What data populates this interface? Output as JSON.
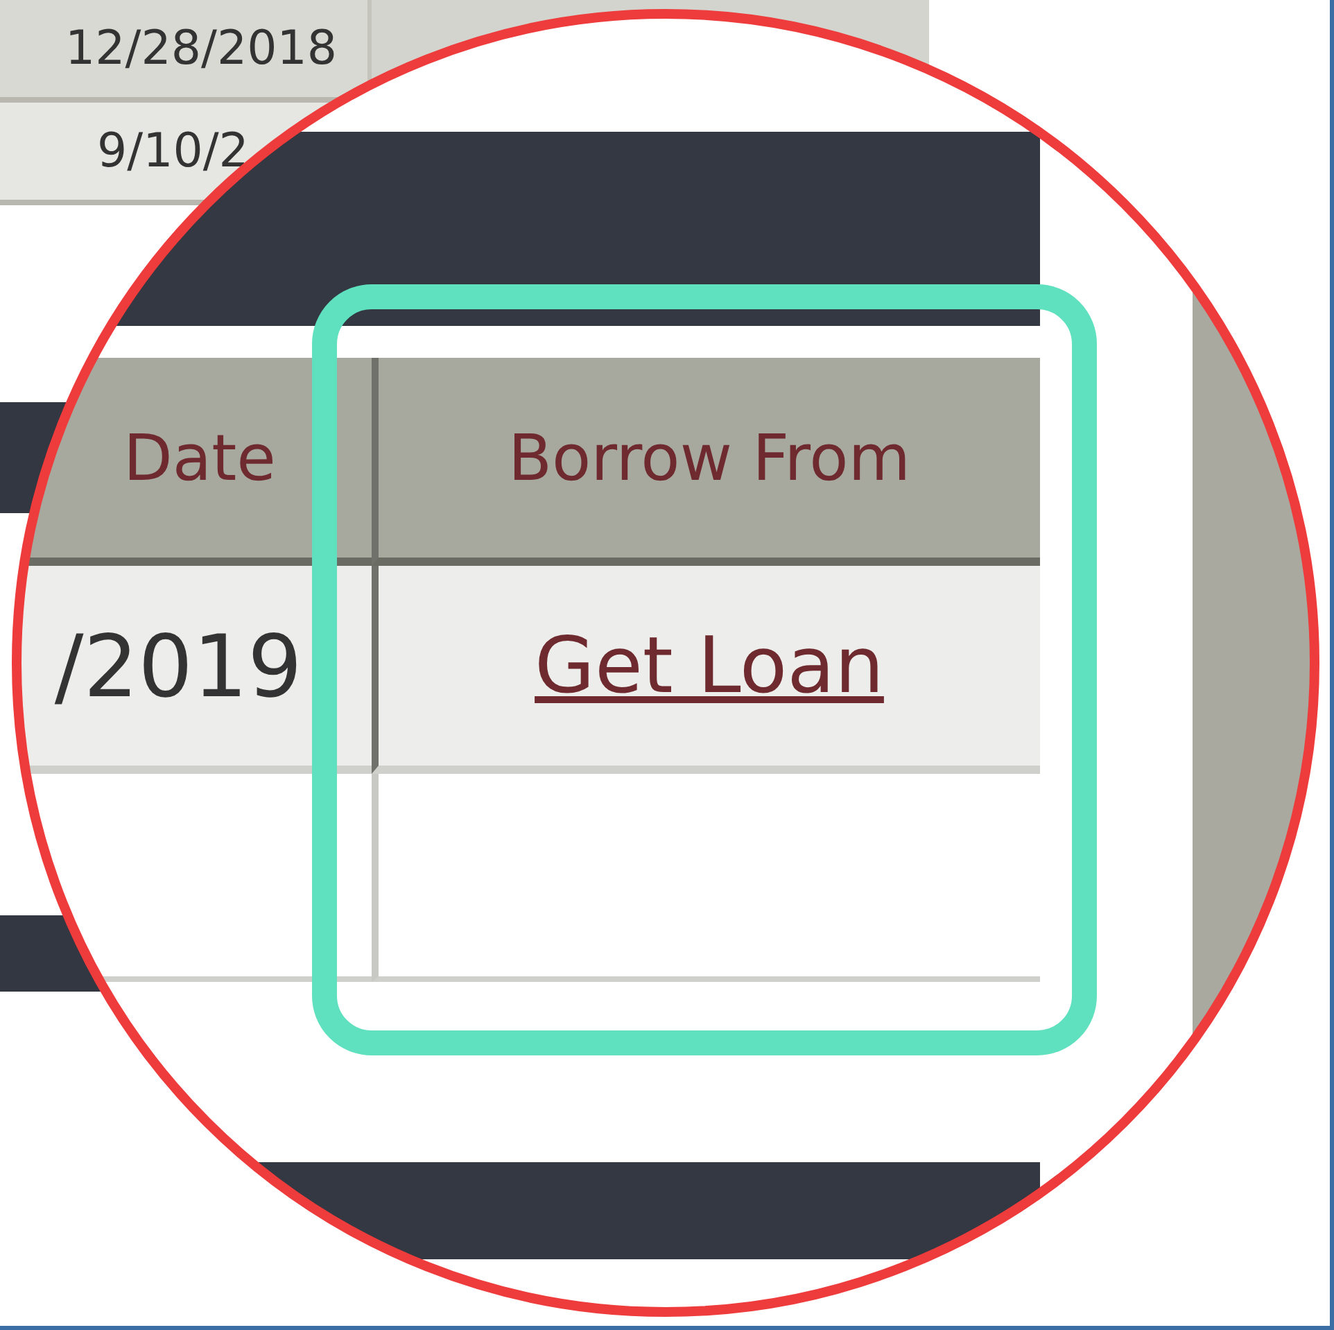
{
  "background_table": {
    "rows": [
      {
        "date": "12/28/2018"
      },
      {
        "date": "9/10/2"
      }
    ]
  },
  "magnified": {
    "table": {
      "columns": [
        "Date",
        "Borrow From"
      ],
      "rows": [
        {
          "date": "/2019",
          "borrow_from": "Get Loan"
        }
      ]
    }
  }
}
